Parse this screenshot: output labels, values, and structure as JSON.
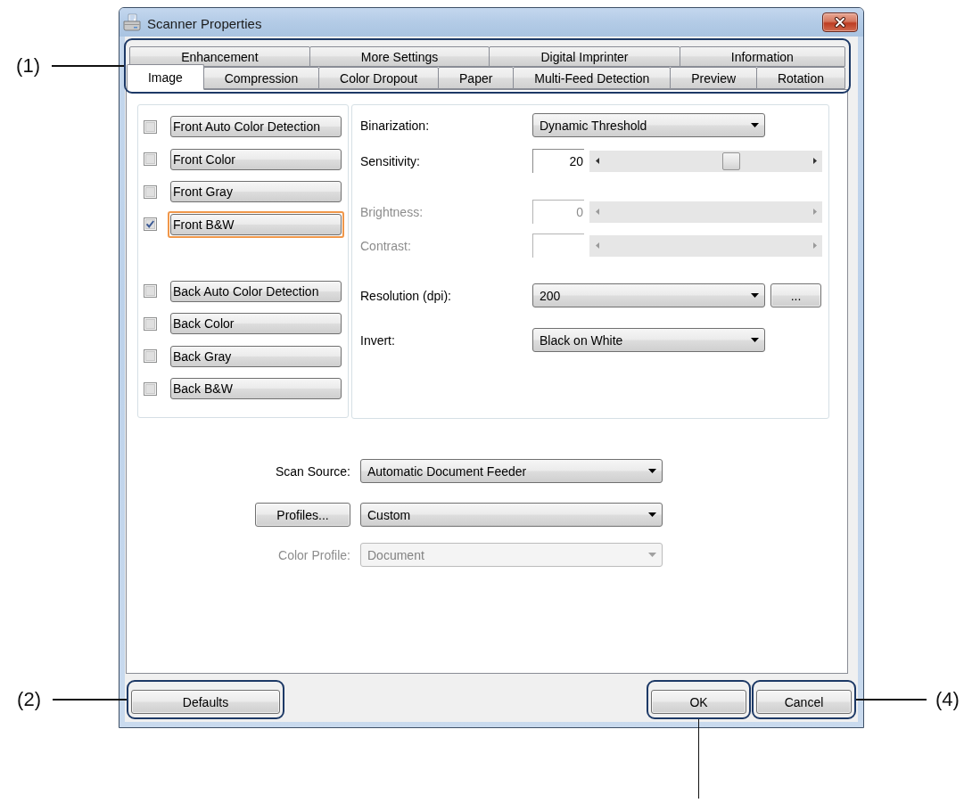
{
  "window": {
    "title": "Scanner Properties"
  },
  "tabs": {
    "highlighted": true,
    "callout": "(1)",
    "rows": [
      {
        "tabs": [
          {
            "label": "Enhancement",
            "selected": false
          },
          {
            "label": "More Settings",
            "selected": false
          },
          {
            "label": "Digital Imprinter",
            "selected": false
          },
          {
            "label": "Information",
            "selected": false
          }
        ]
      },
      {
        "tabs": [
          {
            "label": "Image",
            "selected": true
          },
          {
            "label": "Compression",
            "selected": false
          },
          {
            "label": "Color Dropout",
            "selected": false
          },
          {
            "label": "Paper",
            "selected": false
          },
          {
            "label": "Multi-Feed Detection",
            "selected": false
          },
          {
            "label": "Preview",
            "selected": false
          },
          {
            "label": "Rotation",
            "selected": false
          }
        ]
      }
    ]
  },
  "front_modes": [
    {
      "label": "Front Auto Color Detection",
      "checked": false,
      "selected": false
    },
    {
      "label": "Front Color",
      "checked": false,
      "selected": false
    },
    {
      "label": "Front Gray",
      "checked": false,
      "selected": false
    },
    {
      "label": "Front B&W",
      "checked": true,
      "selected": true
    }
  ],
  "back_modes": [
    {
      "label": "Back Auto Color Detection",
      "checked": false,
      "selected": false
    },
    {
      "label": "Back Color",
      "checked": false,
      "selected": false
    },
    {
      "label": "Back Gray",
      "checked": false,
      "selected": false
    },
    {
      "label": "Back B&W",
      "checked": false,
      "selected": false
    }
  ],
  "settings": [
    {
      "kind": "dropdown",
      "label": "Binarization:",
      "value": "Dynamic Threshold",
      "disabled": false
    },
    {
      "kind": "slider",
      "label": "Sensitivity:",
      "value": "20",
      "level": 0.64,
      "disabled": false
    },
    {
      "kind": "slider",
      "label": "Brightness:",
      "value": "0",
      "disabled": true
    },
    {
      "kind": "slider",
      "label": "Contrast:",
      "disabled": true
    },
    {
      "kind": "dropdown",
      "label": "Resolution (dpi):",
      "value": "200",
      "button": "...",
      "disabled": false
    },
    {
      "kind": "dropdown",
      "label": "Invert:",
      "value": "Black on White",
      "disabled": false
    }
  ],
  "scan_options": [
    {
      "kind": "dropdown",
      "label": "Scan Source:",
      "value": "Automatic Document Feeder",
      "disabled": false
    },
    {
      "kind": "button",
      "button": "Profiles...",
      "value": "Custom",
      "disabled": false
    },
    {
      "kind": "dropdown",
      "label": "Color Profile:",
      "value": "Document",
      "disabled": true
    }
  ],
  "footer": {
    "buttons": [
      {
        "label": "Defaults",
        "highlighted": true,
        "callout": "(2)"
      },
      {
        "label": "OK",
        "highlighted": true
      },
      {
        "label": "Cancel",
        "highlighted": true,
        "callout": "(4)"
      }
    ]
  }
}
